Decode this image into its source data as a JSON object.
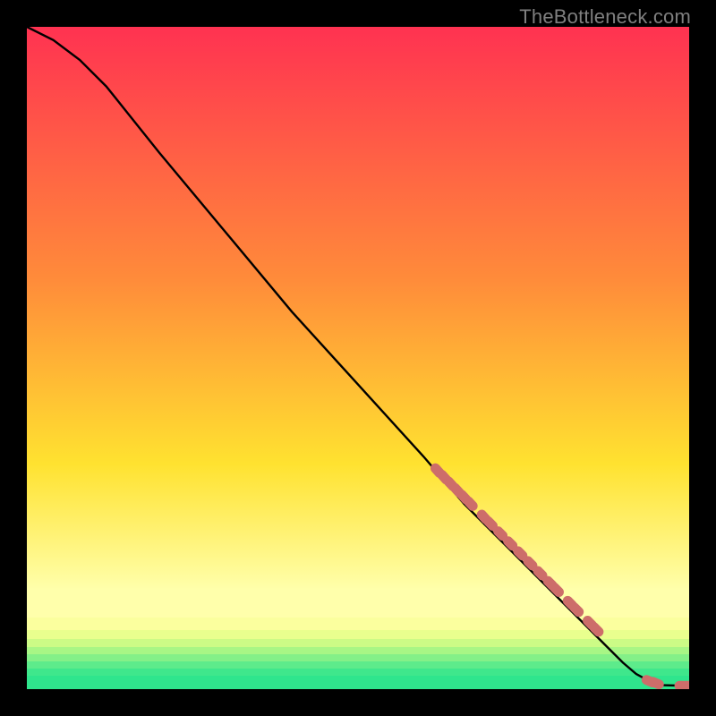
{
  "attribution": "TheBottleneck.com",
  "colors": {
    "marker": "#cd6d6a",
    "line": "#000000",
    "top": "#ff3251",
    "mid1": "#ff8b3a",
    "mid2": "#ffe230",
    "lowband": "#ffffab",
    "green": "#2fe58d"
  },
  "chart_data": {
    "type": "line",
    "title": "",
    "xlabel": "",
    "ylabel": "",
    "xlim": [
      0,
      100
    ],
    "ylim": [
      0,
      100
    ],
    "curve_note": "Monotone decreasing curve from top-left to bottom-right; values are y (0=bottom,100=top) at x (0=left,100=right) estimated from pixels.",
    "curve": [
      {
        "x": 0,
        "y": 100
      },
      {
        "x": 4,
        "y": 98
      },
      {
        "x": 8,
        "y": 95
      },
      {
        "x": 12,
        "y": 91
      },
      {
        "x": 20,
        "y": 81
      },
      {
        "x": 30,
        "y": 69
      },
      {
        "x": 40,
        "y": 57
      },
      {
        "x": 50,
        "y": 46
      },
      {
        "x": 60,
        "y": 35
      },
      {
        "x": 66,
        "y": 28
      },
      {
        "x": 72,
        "y": 22
      },
      {
        "x": 78,
        "y": 16
      },
      {
        "x": 84,
        "y": 10
      },
      {
        "x": 88,
        "y": 6
      },
      {
        "x": 90,
        "y": 4
      },
      {
        "x": 92,
        "y": 2.3
      },
      {
        "x": 94,
        "y": 1.2
      },
      {
        "x": 96,
        "y": 0.6
      },
      {
        "x": 100,
        "y": 0.5
      }
    ],
    "markers_note": "Clusters of salmon-colored rounded markers lying on the curve.",
    "markers": [
      {
        "x": 62,
        "y": 33
      },
      {
        "x": 63,
        "y": 32
      },
      {
        "x": 64,
        "y": 31
      },
      {
        "x": 65,
        "y": 30
      },
      {
        "x": 66,
        "y": 29
      },
      {
        "x": 67,
        "y": 28
      },
      {
        "x": 69,
        "y": 26
      },
      {
        "x": 70,
        "y": 25
      },
      {
        "x": 71.5,
        "y": 23.5
      },
      {
        "x": 73,
        "y": 22
      },
      {
        "x": 74.5,
        "y": 20.5
      },
      {
        "x": 76,
        "y": 19
      },
      {
        "x": 77.5,
        "y": 17.5
      },
      {
        "x": 79,
        "y": 16
      },
      {
        "x": 80,
        "y": 15
      },
      {
        "x": 82,
        "y": 13
      },
      {
        "x": 83,
        "y": 12
      },
      {
        "x": 85,
        "y": 10
      },
      {
        "x": 86,
        "y": 9
      },
      {
        "x": 94,
        "y": 1.2
      },
      {
        "x": 95,
        "y": 0.9
      },
      {
        "x": 99,
        "y": 0.5
      },
      {
        "x": 100,
        "y": 0.5
      }
    ]
  }
}
